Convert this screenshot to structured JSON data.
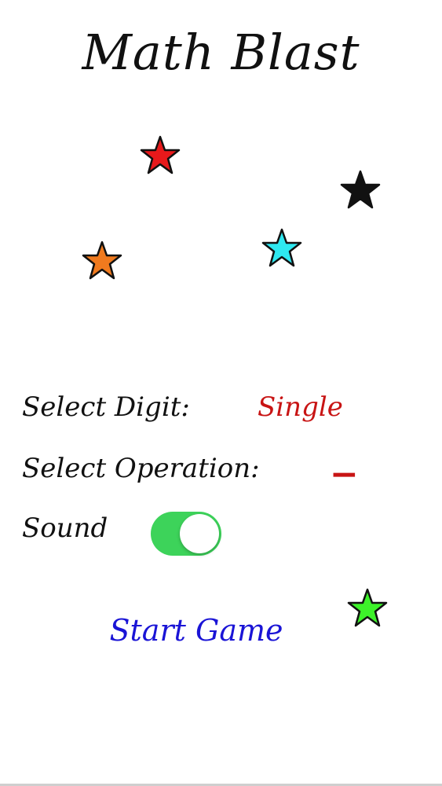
{
  "title": "Math Blast",
  "stars": [
    {
      "color": "#e8191b"
    },
    {
      "color": "#111111"
    },
    {
      "color": "#2ee8f0"
    },
    {
      "color": "#f07a1e"
    },
    {
      "color": "#3df22a"
    }
  ],
  "settings": {
    "digit_label": "Select Digit:",
    "digit_value": "Single",
    "operation_label": "Select Operation:",
    "operation_value": "−",
    "sound_label": "Sound",
    "sound_on": true
  },
  "start_label": "Start Game",
  "colors": {
    "value_red": "#c81414",
    "start_blue": "#1a14d6",
    "toggle_green": "#3dd35a"
  }
}
